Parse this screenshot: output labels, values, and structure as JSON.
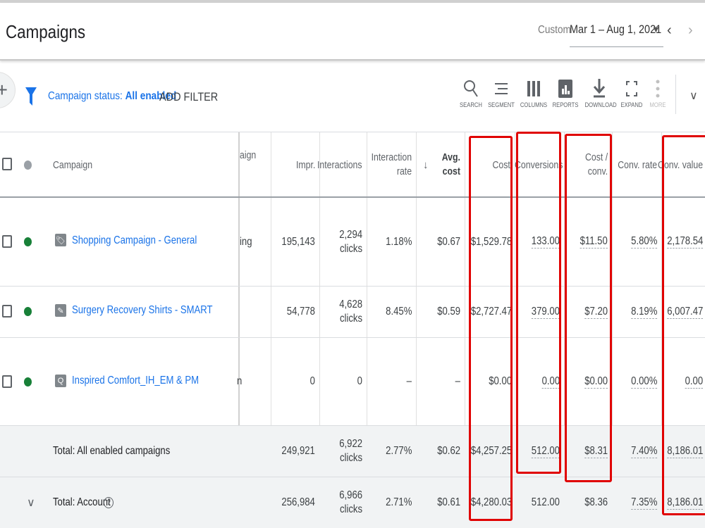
{
  "header": {
    "title": "Campaigns",
    "date_label": "Custom",
    "date_range": "Mar 1 – Aug 1, 2021",
    "dropdown_glyph": "▼",
    "prev_glyph": "‹",
    "next_glyph": "›"
  },
  "toolbar": {
    "add_glyph": "+",
    "filter_prefix": "Campaign status: ",
    "filter_value": "All enabled",
    "add_filter": "ADD FILTER",
    "tools": [
      {
        "label": "SEARCH",
        "icon": "search-icon"
      },
      {
        "label": "SEGMENT",
        "icon": "segment-icon"
      },
      {
        "label": "COLUMNS",
        "icon": "columns-icon"
      },
      {
        "label": "REPORTS",
        "icon": "reports-icon"
      },
      {
        "label": "DOWNLOAD",
        "icon": "download-icon"
      },
      {
        "label": "EXPAND",
        "icon": "expand-icon"
      },
      {
        "label": "MORE",
        "icon": "more-icon"
      }
    ],
    "collapse_glyph": "∨"
  },
  "table": {
    "headers": {
      "campaign": "Campaign",
      "type_partial": "aign",
      "impr": "Impr.",
      "interactions": "Interactions",
      "interaction_rate_1": "Interaction",
      "interaction_rate_2": "rate",
      "sort_glyph": "↓",
      "avg_cost_1": "Avg.",
      "avg_cost_2": "cost",
      "cost": "Cost",
      "conversions": "Conversions",
      "cost_conv_1": "Cost /",
      "cost_conv_2": "conv.",
      "conv_rate": "Conv. rate",
      "conv_value": "Conv. value"
    },
    "rows": [
      {
        "name": "Shopping Campaign - General",
        "icon_glyph": "🏷",
        "type_partial": "ing",
        "impr": "195,143",
        "interactions": "2,294",
        "interactions_unit": "clicks",
        "interaction_rate": "1.18%",
        "avg_cost": "$0.67",
        "cost": "$1,529.78",
        "conversions": "133.00",
        "cost_conv": "$11.50",
        "conv_rate": "5.80%",
        "conv_value": "2,178.54"
      },
      {
        "name": "Surgery Recovery Shirts - SMART",
        "icon_glyph": "✎",
        "type_partial": "",
        "impr": "54,778",
        "interactions": "4,628",
        "interactions_unit": "clicks",
        "interaction_rate": "8.45%",
        "avg_cost": "$0.59",
        "cost": "$2,727.47",
        "conversions": "379.00",
        "cost_conv": "$7.20",
        "conv_rate": "8.19%",
        "conv_value": "6,007.47"
      },
      {
        "name": "Inspired Comfort_IH_EM & PM",
        "icon_glyph": "Q",
        "type_partial": "n",
        "impr": "0",
        "interactions": "0",
        "interactions_unit": "",
        "interaction_rate": "–",
        "avg_cost": "–",
        "cost": "$0.00",
        "conversions": "0.00",
        "cost_conv": "$0.00",
        "conv_rate": "0.00%",
        "conv_value": "0.00"
      }
    ],
    "totals": [
      {
        "label": "Total: All enabled campaigns",
        "impr": "249,921",
        "interactions": "6,922",
        "interactions_unit": "clicks",
        "interaction_rate": "2.77%",
        "avg_cost": "$0.62",
        "cost": "$4,257.25",
        "conversions": "512.00",
        "cost_conv": "$8.31",
        "conv_rate": "7.40%",
        "conv_value": "8,186.01"
      },
      {
        "label": "Total: Account",
        "expand_glyph": "∨",
        "help_glyph": "?",
        "impr": "256,984",
        "interactions": "6,966",
        "interactions_unit": "clicks",
        "interaction_rate": "2.71%",
        "avg_cost": "$0.61",
        "cost": "$4,280.03",
        "conversions": "512.00",
        "cost_conv": "$8.36",
        "conv_rate": "7.35%",
        "conv_value": "8,186.01"
      }
    ]
  },
  "colors": {
    "link": "#1a73e8",
    "status_enabled": "#188038",
    "highlight": "#e00000"
  }
}
